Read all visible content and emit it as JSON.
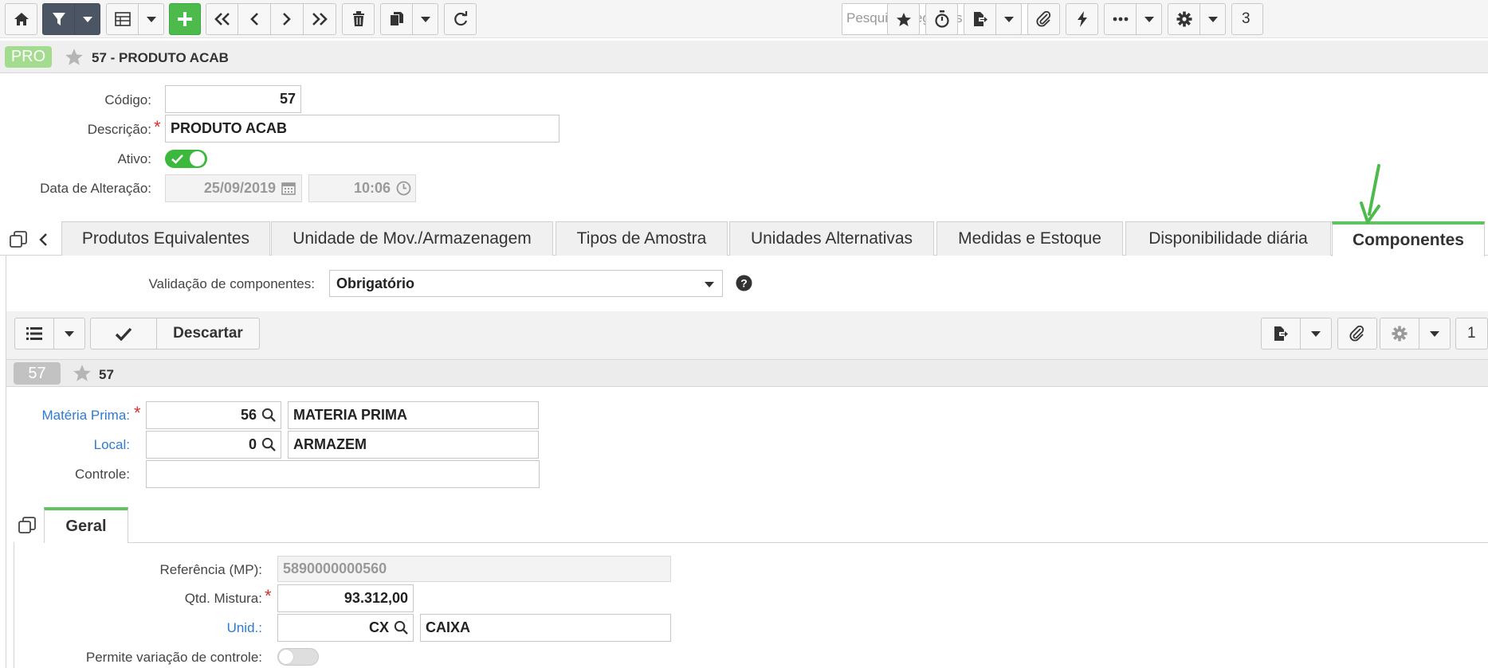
{
  "toolbar": {
    "search_placeholder": "Pesquisar registros...",
    "page_number": "3",
    "buttons": [
      "home-icon",
      "filter-icon",
      "grid-icon",
      "plus-icon",
      "first-icon",
      "prev-icon",
      "next-icon",
      "last-icon",
      "trash-icon",
      "copy-icon",
      "refresh-icon",
      "star-icon",
      "stopwatch-icon",
      "export-icon",
      "paperclip-icon",
      "bolt-icon",
      "more-icon",
      "gear-icon"
    ]
  },
  "record": {
    "badge": "PRO",
    "title": "57 - PRODUTO ACAB"
  },
  "form": {
    "codigo_label": "Código:",
    "codigo_value": "57",
    "descricao_label": "Descrição:",
    "descricao_value": "PRODUTO ACAB",
    "ativo_label": "Ativo:",
    "ativo_value": true,
    "data_label": "Data de Alteração:",
    "data_value": "25/09/2019",
    "hora_value": "10:06"
  },
  "tabs": [
    {
      "label": "Produtos Equivalentes",
      "active": false
    },
    {
      "label": "Unidade de Mov./Armazenagem",
      "active": false
    },
    {
      "label": "Tipos de Amostra",
      "active": false
    },
    {
      "label": "Unidades Alternativas",
      "active": false
    },
    {
      "label": "Medidas e Estoque",
      "active": false
    },
    {
      "label": "Disponibilidade diária",
      "active": false
    },
    {
      "label": "Componentes",
      "active": true
    }
  ],
  "componentes": {
    "validacao_label": "Validação de componentes:",
    "validacao_value": "Obrigatório",
    "descartar_label": "Descartar",
    "page_number": "1",
    "sub_badge": "57",
    "sub_title": "57",
    "materia_label": "Matéria Prima:",
    "materia_code": "56",
    "materia_desc": "MATERIA  PRIMA",
    "local_label": "Local:",
    "local_code": "0",
    "local_desc": "ARMAZEM",
    "controle_label": "Controle:",
    "controle_value": ""
  },
  "geral": {
    "tab_label": "Geral",
    "referencia_label": "Referência (MP):",
    "referencia_value": "5890000000560",
    "qtd_label": "Qtd. Mistura:",
    "qtd_value": "93.312,00",
    "unid_label": "Unid.:",
    "unid_code": "CX",
    "unid_desc": "CAIXA",
    "permite_label": "Permite variação de controle:",
    "permite_value": false
  },
  "colors": {
    "accent_green": "#4cbb4c",
    "dark_button": "#4c5563",
    "link_blue": "#2d7bd4",
    "required_red": "#d9302c"
  }
}
